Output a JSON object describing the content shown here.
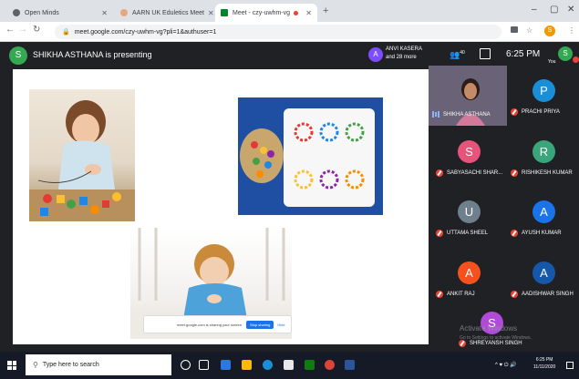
{
  "browser": {
    "tabs": [
      {
        "title": "Open Minds",
        "color": "#5f6368"
      },
      {
        "title": "AARN UK Eduletics Meet",
        "color": "#e8a87c"
      },
      {
        "title": "Meet - czy-uwhm-vg",
        "color": "#00832d"
      }
    ],
    "new_tab": "+",
    "window_controls": {
      "minimize": "–",
      "restore": "▢",
      "close": "✕"
    },
    "url": "meet.google.com/czy-uwhm-vg?pli=1&authuser=1",
    "profile_initial": "S"
  },
  "meet": {
    "presenter_initial": "S",
    "presenting_text": "SHIKHA ASTHANA is presenting",
    "anvi_initial": "A",
    "anvi_line1": "ANVI KASERA",
    "anvi_line2": "and 28 more",
    "people_count": "40",
    "clock": "6:25 PM",
    "you_initial": "S",
    "you_label": "You",
    "share_text": "meet.google.com is sharing your screen",
    "stop_sharing": "Stop sharing",
    "hide": "Hide"
  },
  "participants": [
    {
      "name": "SHIKHA ASTHANA",
      "initial": "",
      "color": ""
    },
    {
      "name": "PRACHI PRIYA",
      "initial": "P",
      "color": "#1a8fd8"
    },
    {
      "name": "SABYASACHI SHAR...",
      "initial": "S",
      "color": "#e8537a"
    },
    {
      "name": "RISHIKESH KUMAR",
      "initial": "R",
      "color": "#3aa57a"
    },
    {
      "name": "UTTAMA SHEEL",
      "initial": "U",
      "color": "#6f7f8c"
    },
    {
      "name": "AYUSH KUMAR",
      "initial": "A",
      "color": "#1a73e8"
    },
    {
      "name": "ANKIT RAJ",
      "initial": "A",
      "color": "#f4511e"
    },
    {
      "name": "AADISHWAR SINGH",
      "initial": "A",
      "color": "#1557a8"
    },
    {
      "name": "SHREYANSH SINGH",
      "initial": "S",
      "color": "#b04bd8"
    }
  ],
  "watermark": {
    "line1": "Activate Windows",
    "line2": "Go to Settings to activate Windows."
  },
  "taskbar": {
    "search_placeholder": "Type here to search",
    "tray": "^ ♥ ⏻ 🔊",
    "time": "6:25 PM",
    "date": "11/11/2020"
  }
}
